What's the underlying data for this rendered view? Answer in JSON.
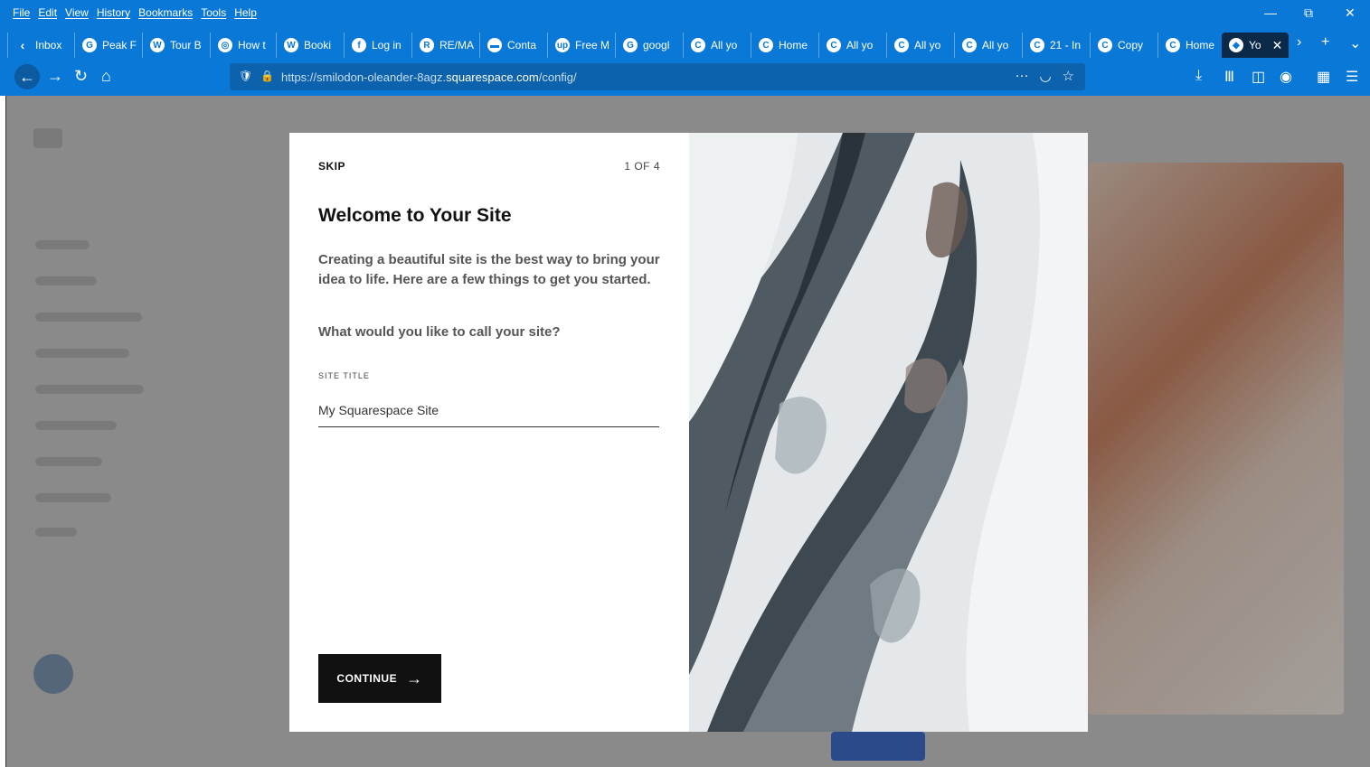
{
  "menu": [
    "File",
    "Edit",
    "View",
    "History",
    "Bookmarks",
    "Tools",
    "Help"
  ],
  "tabs": [
    {
      "label": "Inbox",
      "icon": "chevron-left-icon"
    },
    {
      "label": "Peak F",
      "icon": "google-icon"
    },
    {
      "label": "Tour B",
      "icon": "wordpress-icon"
    },
    {
      "label": "How t",
      "icon": "spiral-icon"
    },
    {
      "label": "Booki",
      "icon": "word-icon"
    },
    {
      "label": "Log in",
      "icon": "facebook-icon"
    },
    {
      "label": "RE/MA",
      "icon": "remax-icon"
    },
    {
      "label": "Conta",
      "icon": "contact-icon"
    },
    {
      "label": "Free M",
      "icon": "up-icon"
    },
    {
      "label": "googl",
      "icon": "google-icon"
    },
    {
      "label": "All yo",
      "icon": "c-icon"
    },
    {
      "label": "Home",
      "icon": "c-icon"
    },
    {
      "label": "All yo",
      "icon": "c-icon"
    },
    {
      "label": "All yo",
      "icon": "c-icon"
    },
    {
      "label": "All yo",
      "icon": "c-icon"
    },
    {
      "label": "21 - In",
      "icon": "c-icon"
    },
    {
      "label": "Copy",
      "icon": "c-icon"
    },
    {
      "label": "Home",
      "icon": "c-icon"
    },
    {
      "label": "Yo",
      "icon": "squarespace-icon",
      "active": true
    }
  ],
  "url": {
    "prefix": "https://smilodon-oleander-8agz.",
    "domain": "squarespace.com",
    "path": "/config/"
  },
  "modal": {
    "skip": "SKIP",
    "step": "1 OF 4",
    "title": "Welcome to Your Site",
    "intro": "Creating a beautiful site is the best way to bring your idea to life. Here are a few things to get you started.",
    "question": "What would you like to call your site?",
    "field_label": "SITE TITLE",
    "field_value": "My Squarespace Site",
    "continue": "CONTINUE"
  },
  "colors": {
    "chrome": "#0a78d7",
    "button": "#111111"
  }
}
